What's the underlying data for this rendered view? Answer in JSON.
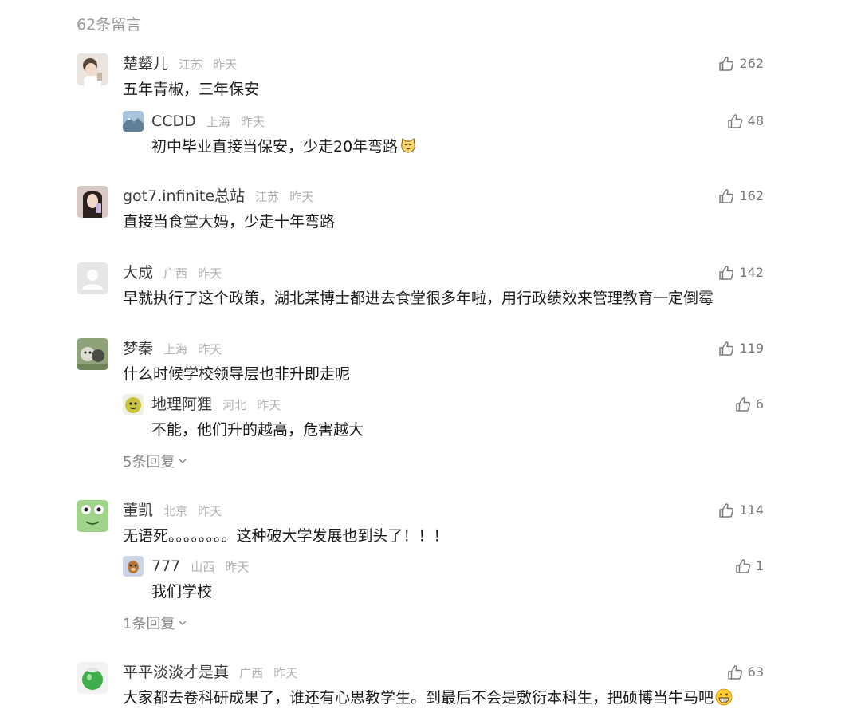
{
  "header": {
    "count_label": "62条留言"
  },
  "comments": [
    {
      "name": "楚颦儿",
      "location": "江苏",
      "time": "昨天",
      "likes": "262",
      "text": "五年青椒，三年保安",
      "reply": {
        "name": "CCDD",
        "location": "上海",
        "time": "昨天",
        "likes": "48",
        "text": "初中毕业直接当保安，少走20年弯路"
      }
    },
    {
      "name": "got7.infinite总站",
      "location": "江苏",
      "time": "昨天",
      "likes": "162",
      "text": "直接当食堂大妈，少走十年弯路"
    },
    {
      "name": "大成",
      "location": "广西",
      "time": "昨天",
      "likes": "142",
      "text": "早就执行了这个政策，湖北某博士都进去食堂很多年啦，用行政绩效来管理教育一定倒霉"
    },
    {
      "name": "梦秦",
      "location": "上海",
      "time": "昨天",
      "likes": "119",
      "text": "什么时候学校领导层也非升即走呢",
      "reply": {
        "name": "地理阿狸",
        "location": "河北",
        "time": "昨天",
        "likes": "6",
        "text": "不能，他们升的越高，危害越大"
      },
      "more_replies": "5条回复"
    },
    {
      "name": "董凯",
      "location": "北京",
      "time": "昨天",
      "likes": "114",
      "text": "无语死。。。。。。。。这种破大学发展也到头了！！！",
      "reply": {
        "name": "777",
        "location": "山西",
        "time": "昨天",
        "likes": "1",
        "text": "我们学校"
      },
      "more_replies": "1条回复"
    },
    {
      "name": "平平淡淡才是真",
      "location": "广西",
      "time": "昨天",
      "likes": "63",
      "text": "大家都去卷科研成果了，谁还有心思教学生。到最后不会是敷衍本科生，把硕博当牛马吧"
    }
  ],
  "colors": {
    "name": "#3a3a3a",
    "meta": "#b0b0b0",
    "text": "#1a1a1a",
    "more": "#8a8a8a"
  }
}
